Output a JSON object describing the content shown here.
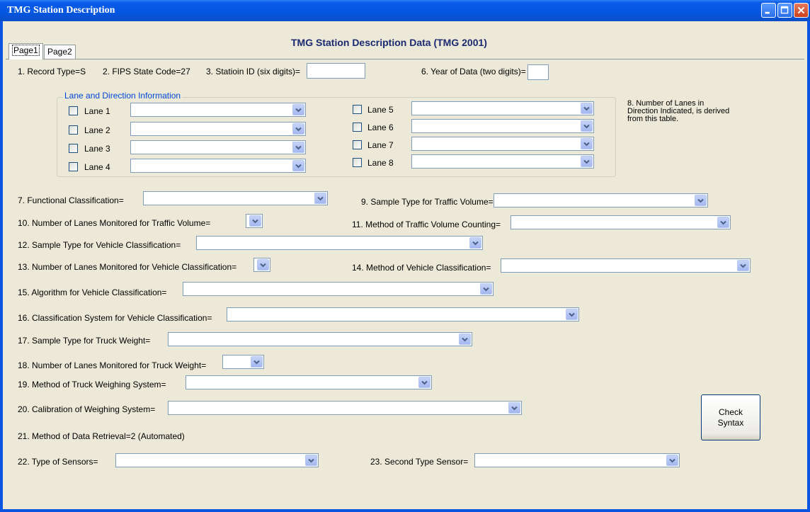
{
  "window": {
    "title": "TMG Station Description"
  },
  "heading": "TMG Station Description Data (TMG 2001)",
  "tabs": [
    "Page1",
    "Page2"
  ],
  "row1": {
    "record_type": "1. Record Type=S",
    "fips": "2. FIPS State Code=27",
    "station_id": "3. Statioin ID (six digits)=",
    "year": "6. Year of Data (two digits)="
  },
  "lanes": {
    "legend": "Lane and Direction Information",
    "items": [
      "Lane 1",
      "Lane 2",
      "Lane 3",
      "Lane 4",
      "Lane 5",
      "Lane 6",
      "Lane 7",
      "Lane 8"
    ],
    "note": "8. Number of Lanes in Direction Indicated, is derived from this table."
  },
  "fields": {
    "f7": "7. Functional Classification=",
    "f9": "9. Sample Type for Traffic Volume=",
    "f10": "10. Number of Lanes Monitored for Traffic Volume=",
    "f11": "11. Method of Traffic Volume Counting=",
    "f12": "12. Sample Type for Vehicle Classification=",
    "f13": "13. Number of Lanes Monitored for Vehicle Classification=",
    "f14": "14. Method of Vehicle Classification=",
    "f15": "15. Algorithm for Vehicle Classification=",
    "f16": "16. Classification System for Vehicle Classification=",
    "f17": "17. Sample Type for Truck Weight=",
    "f18": "18. Number of Lanes Monitored for Truck Weight=",
    "f19": "19. Method of Truck Weighing System=",
    "f20": "20. Calibration of Weighing System=",
    "f21": "21. Method of Data Retrieval=2 (Automated)",
    "f22": "22. Type of Sensors=",
    "f23": "23. Second Type Sensor="
  },
  "buttons": {
    "check_syntax_line1": "Check",
    "check_syntax_line2": "Syntax"
  }
}
